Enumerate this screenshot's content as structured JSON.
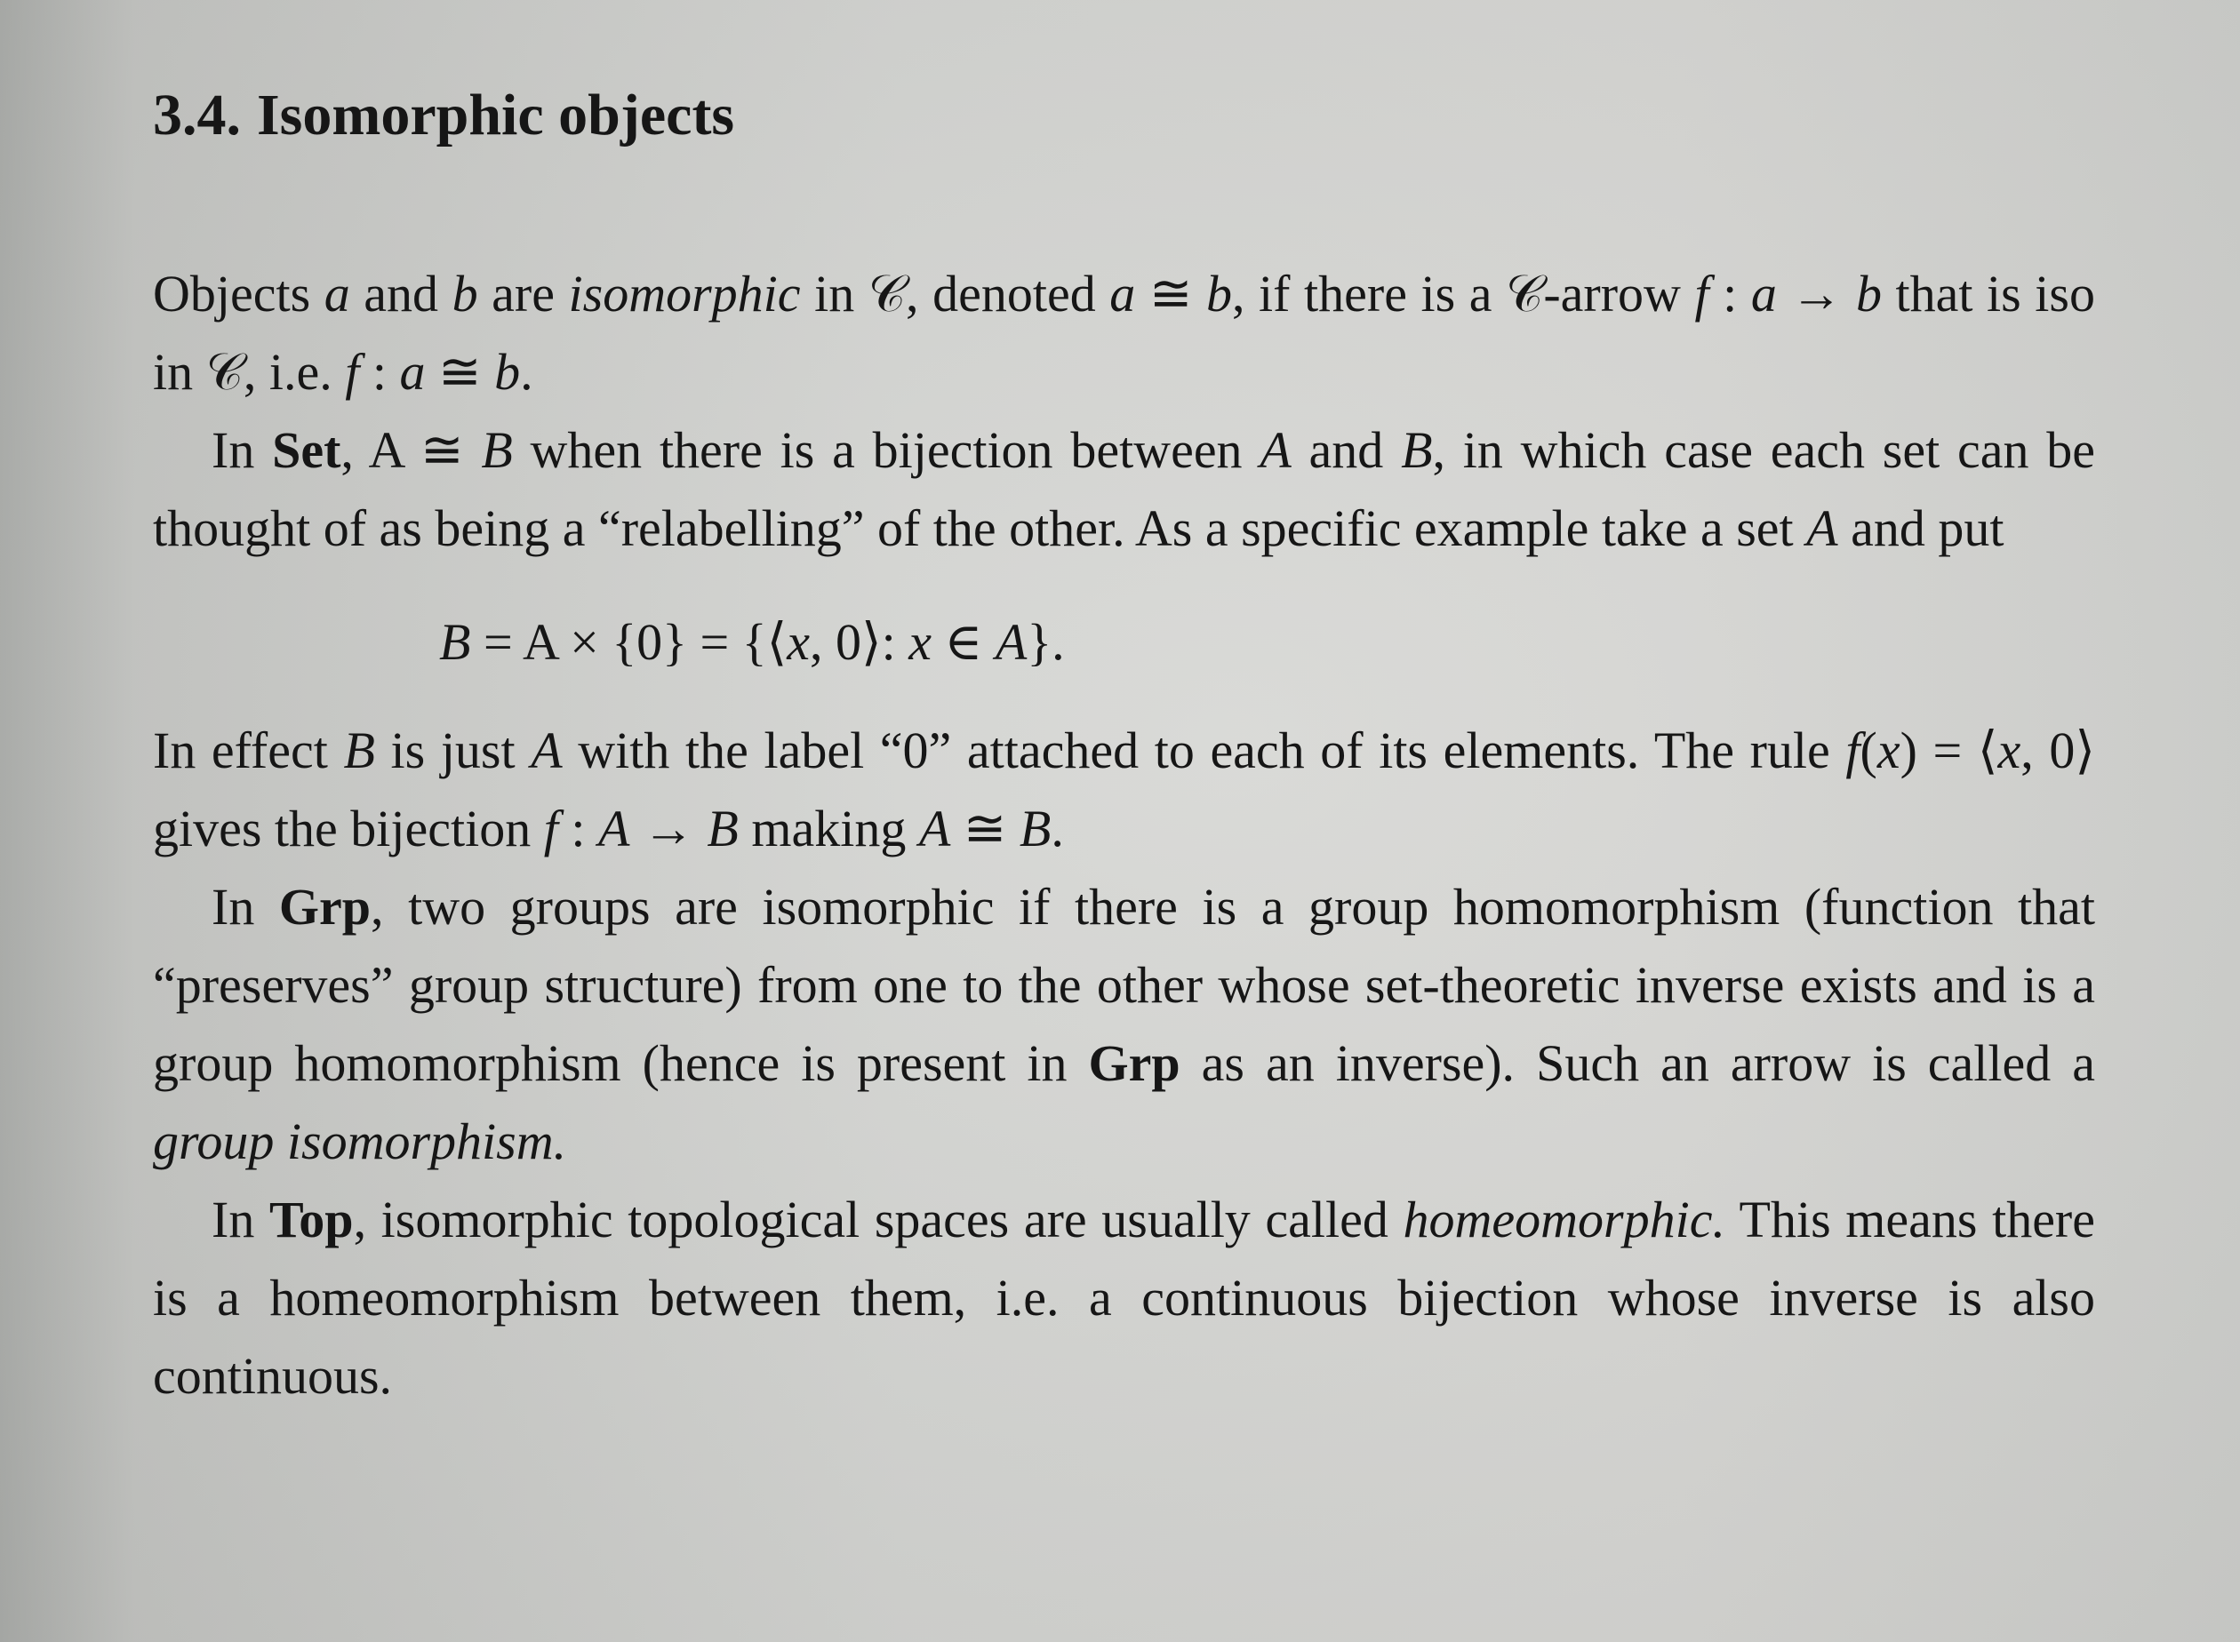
{
  "section": {
    "number": "3.4.",
    "title": "Isomorphic objects"
  },
  "paragraphs": [
    {
      "id": "p1",
      "runs": [
        {
          "t": "Objects "
        },
        {
          "t": "a",
          "s": "it"
        },
        {
          "t": " and "
        },
        {
          "t": "b",
          "s": "it"
        },
        {
          "t": " are "
        },
        {
          "t": "isomorphic",
          "s": "it"
        },
        {
          "t": " in 𝒞, denoted "
        },
        {
          "t": "a",
          "s": "it"
        },
        {
          "t": " ≅ "
        },
        {
          "t": "b",
          "s": "it"
        },
        {
          "t": ", if there is a 𝒞-arrow "
        },
        {
          "t": "f",
          "s": "it"
        },
        {
          "t": " : "
        },
        {
          "t": "a",
          "s": "it"
        },
        {
          "t": " → "
        },
        {
          "t": "b",
          "s": "it"
        },
        {
          "t": " that is iso in 𝒞, i.e. "
        },
        {
          "t": "f",
          "s": "it"
        },
        {
          "t": " : "
        },
        {
          "t": "a",
          "s": "it"
        },
        {
          "t": " ≅ "
        },
        {
          "t": "b",
          "s": "it"
        },
        {
          "t": "."
        }
      ]
    },
    {
      "id": "p2",
      "indent": true,
      "runs": [
        {
          "t": "In "
        },
        {
          "t": "Set",
          "s": "bf"
        },
        {
          "t": ", A ≅ "
        },
        {
          "t": "B",
          "s": "it"
        },
        {
          "t": " when there is a bijection between "
        },
        {
          "t": "A",
          "s": "it"
        },
        {
          "t": " and "
        },
        {
          "t": "B",
          "s": "it"
        },
        {
          "t": ", in which case each set can be thought of as being a “relabelling” of the other. As a specific example take a set "
        },
        {
          "t": "A",
          "s": "it"
        },
        {
          "t": " and put"
        }
      ]
    },
    {
      "id": "display",
      "display": true,
      "runs": [
        {
          "t": "B",
          "s": "it"
        },
        {
          "t": " = A × {0} = {⟨"
        },
        {
          "t": "x",
          "s": "it"
        },
        {
          "t": ", 0⟩: "
        },
        {
          "t": "x",
          "s": "it"
        },
        {
          "t": " ∈ "
        },
        {
          "t": "A",
          "s": "it"
        },
        {
          "t": "}."
        }
      ]
    },
    {
      "id": "p3",
      "runs": [
        {
          "t": "In effect "
        },
        {
          "t": "B",
          "s": "it"
        },
        {
          "t": " is just "
        },
        {
          "t": "A",
          "s": "it"
        },
        {
          "t": " with the label “0” attached to each of its elements. The rule "
        },
        {
          "t": "f",
          "s": "it"
        },
        {
          "t": "("
        },
        {
          "t": "x",
          "s": "it"
        },
        {
          "t": ") = ⟨"
        },
        {
          "t": "x",
          "s": "it"
        },
        {
          "t": ", 0⟩ gives the bijection "
        },
        {
          "t": "f",
          "s": "it"
        },
        {
          "t": " : "
        },
        {
          "t": "A",
          "s": "it"
        },
        {
          "t": " → "
        },
        {
          "t": "B",
          "s": "it"
        },
        {
          "t": " making "
        },
        {
          "t": "A",
          "s": "it"
        },
        {
          "t": " ≅ "
        },
        {
          "t": "B",
          "s": "it"
        },
        {
          "t": "."
        }
      ]
    },
    {
      "id": "p4",
      "indent": true,
      "runs": [
        {
          "t": "In "
        },
        {
          "t": "Grp",
          "s": "bf"
        },
        {
          "t": ", two groups are isomorphic if there is a group homomorphism (function that “preserves” group structure) from one to the other whose set-theoretic inverse exists and is a group homomorphism (hence is present in "
        },
        {
          "t": "Grp",
          "s": "bf"
        },
        {
          "t": " as an inverse). Such an arrow is called a "
        },
        {
          "t": "group isomorphism.",
          "s": "it"
        }
      ]
    },
    {
      "id": "p5",
      "indent": true,
      "runs": [
        {
          "t": "In "
        },
        {
          "t": "Top",
          "s": "bf"
        },
        {
          "t": ", isomorphic topological spaces are usually called "
        },
        {
          "t": "homeomorphic.",
          "s": "it"
        },
        {
          "t": " This means there is a homeomorphism between them, i.e. a continuous bijection whose inverse is also continuous."
        }
      ]
    }
  ]
}
